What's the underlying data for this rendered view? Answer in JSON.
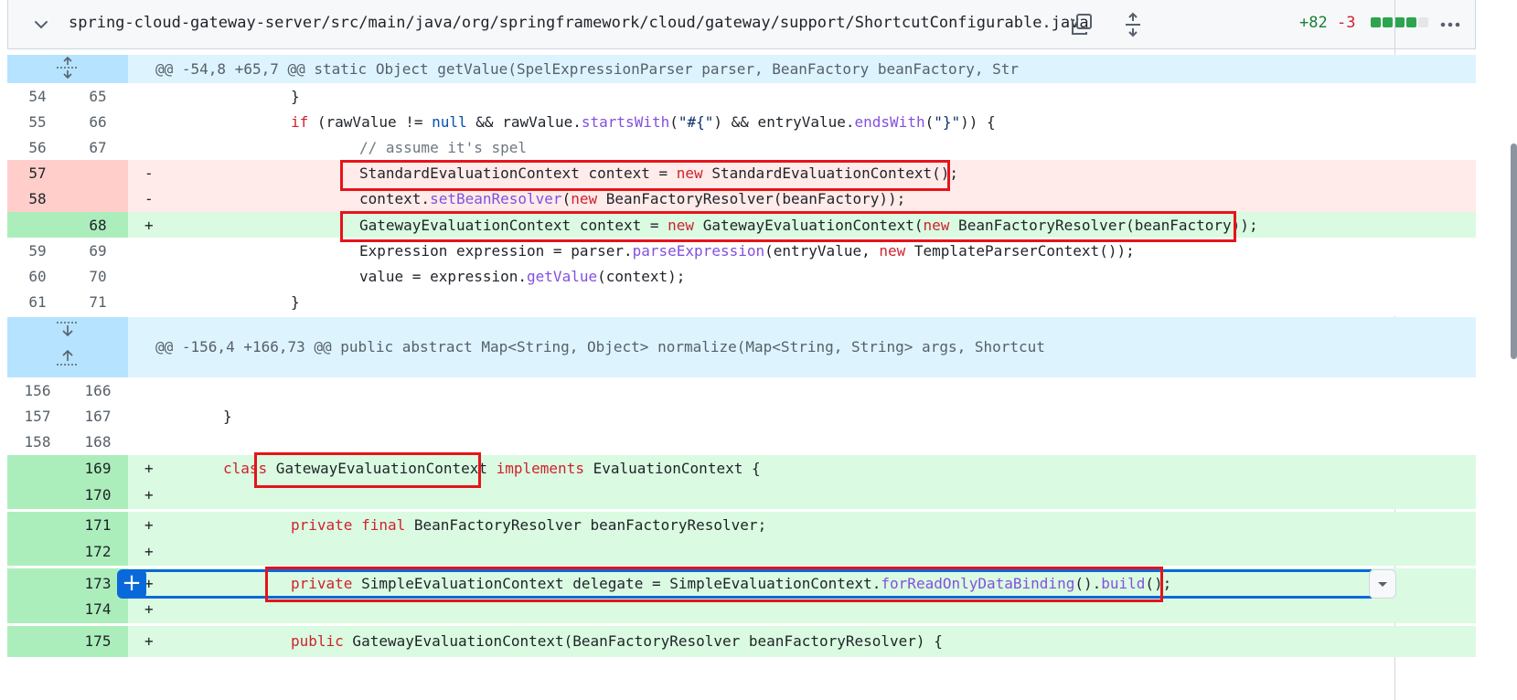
{
  "file": {
    "path": "spring-cloud-gateway-server/src/main/java/org/springframework/cloud/gateway/support/ShortcutConfigurable.java",
    "additions": "+82",
    "deletions": "-3",
    "icons": {
      "collapse": "chevron-down-icon",
      "copy": "copy-icon",
      "expand": "expand-all-icon",
      "more": "kebab-horizontal-icon"
    },
    "colors": {
      "add": "#1a7f37",
      "del": "#cf222e",
      "annotation_box": "#e5141a",
      "selection": "#0969da"
    }
  },
  "hunks": [
    {
      "text": "@@ -54,8 +65,7 @@ static Object getValue(SpelExpressionParser parser, BeanFactory beanFactory, Str"
    },
    {
      "text": "@@ -156,4 +166,73 @@ public abstract Map<String, Object> normalize(Map<String, String> args, Shortcut"
    }
  ],
  "lines": [
    {
      "old": "54",
      "new": "65",
      "marker": "",
      "code": "}"
    },
    {
      "old": "55",
      "new": "66",
      "marker": "",
      "code": "if (rawValue != null && rawValue.startsWith(\"#{\") && entryValue.endsWith(\"}\")) {"
    },
    {
      "old": "56",
      "new": "67",
      "marker": "",
      "code": "// assume it's spel"
    },
    {
      "old": "57",
      "new": "",
      "marker": "-",
      "code": "StandardEvaluationContext context = new StandardEvaluationContext();"
    },
    {
      "old": "58",
      "new": "",
      "marker": "-",
      "code": "context.setBeanResolver(new BeanFactoryResolver(beanFactory));"
    },
    {
      "old": "",
      "new": "68",
      "marker": "+",
      "code": "GatewayEvaluationContext context = new GatewayEvaluationContext(new BeanFactoryResolver(beanFactory));"
    },
    {
      "old": "59",
      "new": "69",
      "marker": "",
      "code": "Expression expression = parser.parseExpression(entryValue, new TemplateParserContext());"
    },
    {
      "old": "60",
      "new": "70",
      "marker": "",
      "code": "value = expression.getValue(context);"
    },
    {
      "old": "61",
      "new": "71",
      "marker": "",
      "code": "}"
    },
    {
      "old": "156",
      "new": "166",
      "marker": "",
      "code": ""
    },
    {
      "old": "157",
      "new": "167",
      "marker": "",
      "code": "}"
    },
    {
      "old": "158",
      "new": "168",
      "marker": "",
      "code": ""
    },
    {
      "old": "",
      "new": "169",
      "marker": "+",
      "code": "class GatewayEvaluationContext implements EvaluationContext {"
    },
    {
      "old": "",
      "new": "170",
      "marker": "+",
      "code": ""
    },
    {
      "old": "",
      "new": "171",
      "marker": "+",
      "code": "private final BeanFactoryResolver beanFactoryResolver;"
    },
    {
      "old": "",
      "new": "172",
      "marker": "+",
      "code": ""
    },
    {
      "old": "",
      "new": "173",
      "marker": "+",
      "code": "private SimpleEvaluationContext delegate = SimpleEvaluationContext.forReadOnlyDataBinding().build();"
    },
    {
      "old": "",
      "new": "174",
      "marker": "+",
      "code": ""
    },
    {
      "old": "",
      "new": "175",
      "marker": "+",
      "code": "public GatewayEvaluationContext(BeanFactoryResolver beanFactoryResolver) {"
    }
  ]
}
